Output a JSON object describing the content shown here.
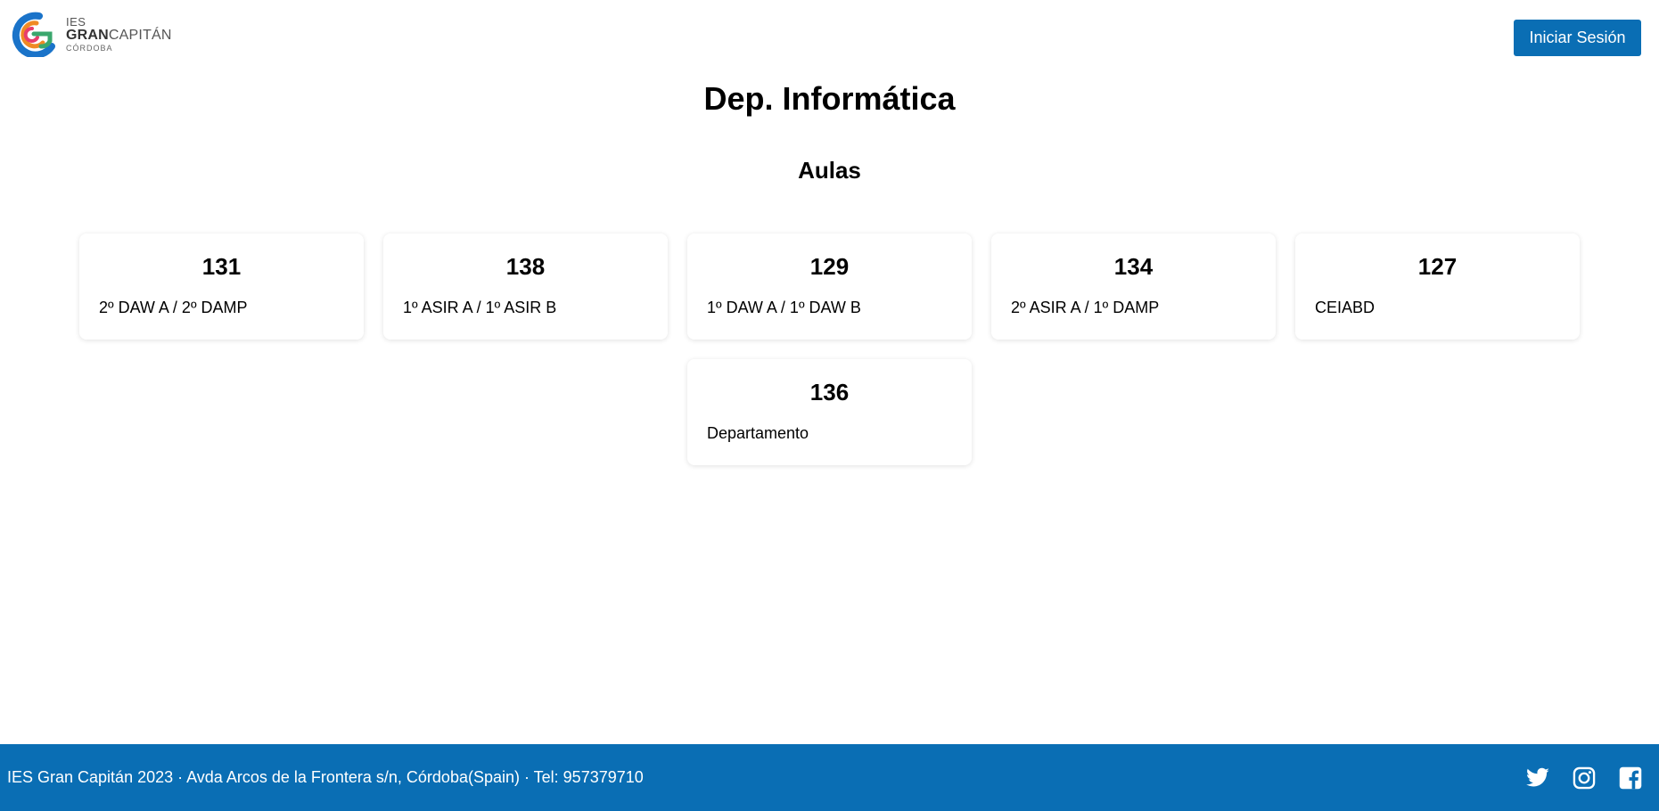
{
  "header": {
    "logo": {
      "line1": "IES",
      "line2_bold": "GRAN",
      "line2_light": "CAPITÁN",
      "line3": "CÓRDOBA"
    },
    "login_label": "Iniciar Sesión"
  },
  "main": {
    "title": "Dep. Informática",
    "section_title": "Aulas",
    "rooms": [
      {
        "number": "131",
        "groups": "2º DAW A / 2º DAMP"
      },
      {
        "number": "138",
        "groups": "1º ASIR A / 1º ASIR B"
      },
      {
        "number": "129",
        "groups": "1º DAW A / 1º DAW B"
      },
      {
        "number": "134",
        "groups": "2º ASIR A / 1º DAMP"
      },
      {
        "number": "127",
        "groups": "CEIABD"
      },
      {
        "number": "136",
        "groups": "Departamento"
      }
    ]
  },
  "footer": {
    "text": "IES Gran Capitán 2023 · Avda Arcos de la Frontera s/n, Córdoba(Spain) · Tel: 957379710",
    "social": [
      "twitter-icon",
      "instagram-icon",
      "facebook-icon"
    ]
  },
  "colors": {
    "primary": "#0a6eb4",
    "logo_blue": "#1a73c9",
    "logo_orange": "#f08a24",
    "logo_pink": "#e83e6c",
    "logo_green": "#3aa76d"
  }
}
